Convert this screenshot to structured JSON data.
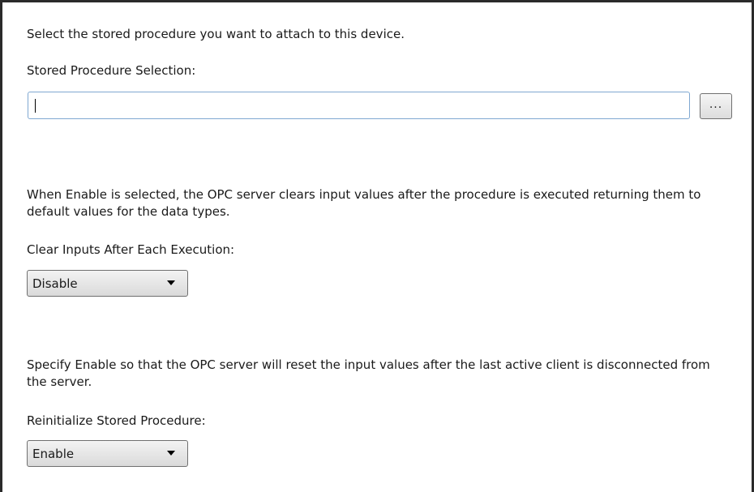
{
  "stored_procedure": {
    "description": "Select the stored procedure you want to attach to this device.",
    "label": "Stored Procedure Selection:",
    "value": "",
    "browse_label": "..."
  },
  "clear_inputs": {
    "description": "When Enable is selected, the OPC server clears input values after the procedure is executed returning them to default values for the data types.",
    "label": "Clear Inputs After Each Execution:",
    "selected": "Disable"
  },
  "reinitialize": {
    "description": "Specify Enable so that the OPC server will reset the input values after the last active client is disconnected from the server.",
    "label": "Reinitialize Stored Procedure:",
    "selected": "Enable"
  }
}
